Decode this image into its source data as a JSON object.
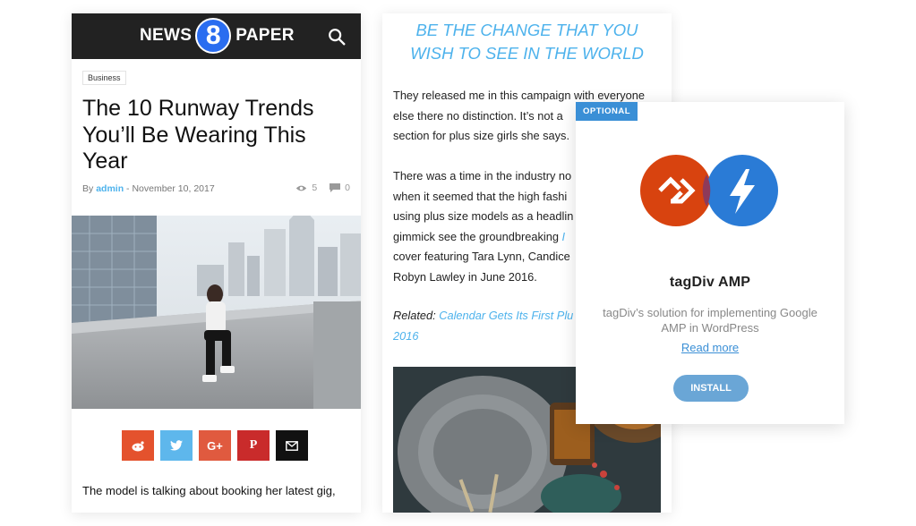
{
  "phone1": {
    "logo": {
      "left_word": "NEWS",
      "badge": "8",
      "right_word": "PAPER"
    },
    "category": "Business",
    "title": "The 10 Runway Trends You’ll Be Wearing This Year",
    "meta": {
      "by": "By",
      "author": "admin",
      "separator": "-",
      "date": "November 10, 2017",
      "views": "5",
      "comments": "0"
    },
    "share_buttons": [
      {
        "name": "reddit",
        "color": "#e4522d"
      },
      {
        "name": "twitter",
        "color": "#5eb7ec",
        "glyph": ""
      },
      {
        "name": "google-plus",
        "color": "#e05a3f",
        "glyph": "G+"
      },
      {
        "name": "pinterest",
        "color": "#c92b2b",
        "glyph": "P"
      },
      {
        "name": "email",
        "color": "#111111",
        "glyph": ""
      }
    ],
    "body_text": "The model is talking about booking her latest gig,"
  },
  "phone2": {
    "quote": "BE THE CHANGE THAT YOU WISH TO SEE IN THE WORLD",
    "para1": [
      "They released me in this campaign with everyone",
      "else there no distinction. It’s not a",
      "section for plus size girls she says."
    ],
    "para2": [
      "There was a time in the industry no",
      "when it seemed that the high fashi",
      "using plus size models as a headlin",
      "gimmick see the groundbreaking ",
      "cover featuring Tara Lynn, Candice",
      "Robyn Lawley in June 2016."
    ],
    "para2_link": "I",
    "related_label": "Related:",
    "related_link": "Calendar Gets Its First Plu",
    "related_link2": "2016"
  },
  "card": {
    "badge": "OPTIONAL",
    "name": "tagDiv AMP",
    "description": "tagDiv’s solution for implementing Google AMP in WordPress",
    "read_more": "Read more",
    "install": "INSTALL",
    "colors": {
      "tagdiv_logo": "#d8430f",
      "amp_logo": "#2a7bd6",
      "button": "#6aa6d6"
    }
  }
}
